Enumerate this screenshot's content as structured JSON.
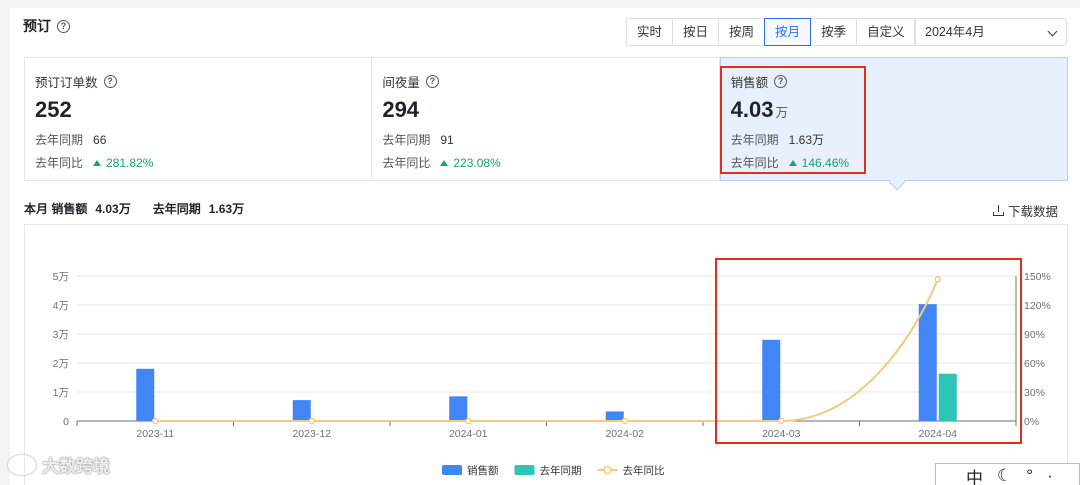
{
  "header": {
    "title": "预订",
    "periods": [
      "实时",
      "按日",
      "按周",
      "按月",
      "按季",
      "自定义"
    ],
    "active_period": "按月",
    "month_select": "2024年4月"
  },
  "cards": [
    {
      "label": "预订订单数",
      "value": "252",
      "unit": "",
      "ly_label": "去年同期",
      "ly_value": "66",
      "yoy_label": "去年同比",
      "yoy_value": "281.82%"
    },
    {
      "label": "间夜量",
      "value": "294",
      "unit": "",
      "ly_label": "去年同期",
      "ly_value": "91",
      "yoy_label": "去年同比",
      "yoy_value": "223.08%"
    },
    {
      "label": "销售额",
      "value": "4.03",
      "unit": "万",
      "ly_label": "去年同期",
      "ly_value": "1.63万",
      "yoy_label": "去年同比",
      "yoy_value": "146.46%"
    }
  ],
  "summary": {
    "prefix": "本月 销售额",
    "current_value": "4.03万",
    "ly_label": "去年同期",
    "ly_value": "1.63万"
  },
  "download_label": "下载数据",
  "chart_data": {
    "type": "bar",
    "categories": [
      "2023-11",
      "2023-12",
      "2024-01",
      "2024-02",
      "2024-03",
      "2024-04"
    ],
    "series": [
      {
        "name": "销售额",
        "type": "bar",
        "color": "#4285f4",
        "values": [
          1.8,
          0.72,
          0.85,
          0.33,
          2.8,
          4.03
        ]
      },
      {
        "name": "去年同期",
        "type": "bar",
        "color": "#2ec4b6",
        "values": [
          0,
          0,
          0,
          0,
          0,
          1.63
        ]
      },
      {
        "name": "去年同比",
        "type": "line",
        "axis": "right",
        "color": "#f7c97e",
        "values": [
          0,
          0,
          0,
          0,
          0,
          146.46
        ]
      }
    ],
    "y_left_ticks": [
      "0",
      "1万",
      "2万",
      "3万",
      "4万",
      "5万"
    ],
    "ylim_left": [
      0,
      5
    ],
    "y_right_ticks": [
      "0%",
      "30%",
      "60%",
      "90%",
      "120%",
      "150%"
    ],
    "ylim_right": [
      0,
      150
    ],
    "grid": true,
    "legend_position": "bottom-center"
  },
  "watermark": "大数跨境",
  "ime": {
    "lang": "中",
    "icons": [
      "moon-icon",
      "punctuation-icon",
      "more-icon"
    ]
  }
}
